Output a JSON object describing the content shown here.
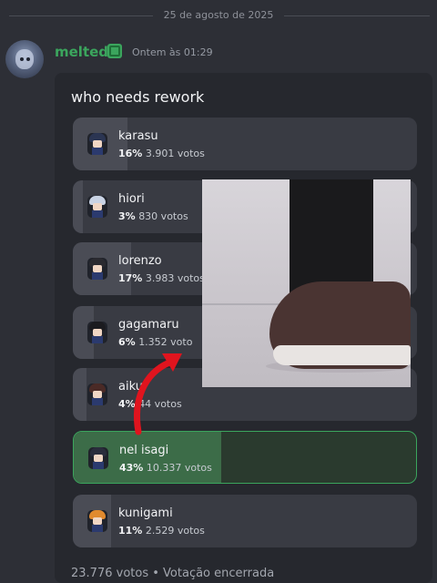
{
  "date_divider": "25 de agosto de 2025",
  "message": {
    "username": "melted",
    "timestamp": "Ontem às 01:29"
  },
  "poll": {
    "question": "who needs rework",
    "options": [
      {
        "label": "karasu",
        "percent": "16%",
        "votes": "3.901 votos",
        "fraction": 0.16,
        "hair": "#2b3552"
      },
      {
        "label": "hiori",
        "percent": "3%",
        "votes": "830 votos",
        "fraction": 0.03,
        "hair": "#c9d3e4"
      },
      {
        "label": "lorenzo",
        "percent": "17%",
        "votes": "3.983 votos",
        "fraction": 0.17,
        "hair": "#2a2a30"
      },
      {
        "label": "gagamaru",
        "percent": "6%",
        "votes": "1.352 voto",
        "fraction": 0.06,
        "hair": "#1b1b1f"
      },
      {
        "label": "aiku",
        "percent": "4%",
        "votes": "44 votos",
        "fraction": 0.04,
        "hair": "#4a2a26"
      },
      {
        "label": "nel isagi",
        "percent": "43%",
        "votes": "10.337 votos",
        "fraction": 0.43,
        "hair": "#2a2d3c"
      },
      {
        "label": "kunigami",
        "percent": "11%",
        "votes": "2.529 votos",
        "fraction": 0.11,
        "hair": "#e08a2e"
      }
    ],
    "total_votes": "23.776 votos",
    "separator": "•",
    "status": "Votação encerrada"
  },
  "colors": {
    "accent": "#3ba55d",
    "arrow": "#e0141e"
  }
}
